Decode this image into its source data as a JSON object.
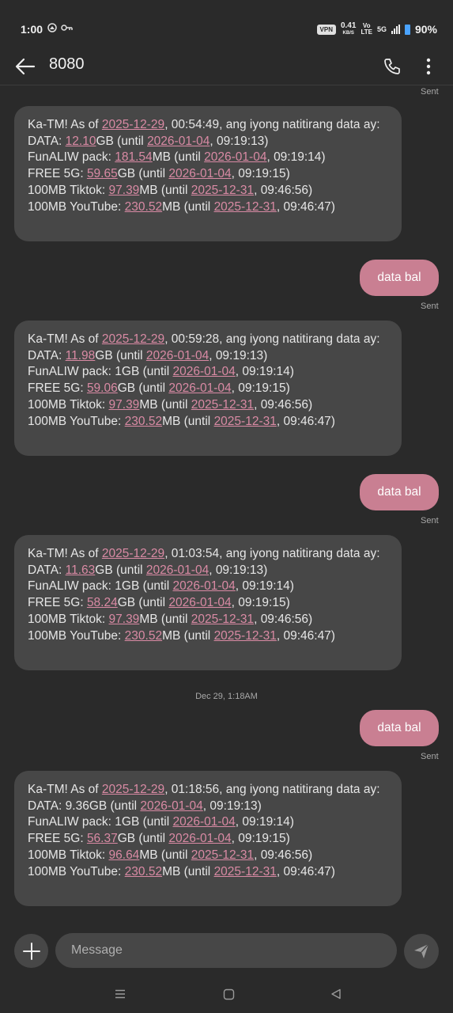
{
  "status_bar": {
    "time": "1:00",
    "vpn": "VPN",
    "net_speed_value": "0.41",
    "net_speed_unit": "KB/S",
    "volte_top": "Vo",
    "volte_bottom": "LTE",
    "network_type": "5G",
    "battery": "90%"
  },
  "header": {
    "title": "8080"
  },
  "thread": {
    "top_status": "Sent",
    "messages": [
      {
        "lines": [
          [
            {
              "t": "Ka-TM! As of "
            },
            {
              "t": "2025-12-29",
              "l": 1
            },
            {
              "t": ", 00:54:49, ang iyong natitirang data ay:"
            }
          ],
          [
            {
              "t": "DATA: "
            },
            {
              "t": "12.10",
              "l": 1
            },
            {
              "t": "GB (until "
            },
            {
              "t": "2026-01-04",
              "l": 1
            },
            {
              "t": ", 09:19:13)"
            }
          ],
          [
            {
              "t": "FunALIW pack: "
            },
            {
              "t": "181.54",
              "l": 1
            },
            {
              "t": "MB (until "
            },
            {
              "t": "2026-01-04",
              "l": 1
            },
            {
              "t": ", 09:19:14)"
            }
          ],
          [
            {
              "t": "FREE 5G: "
            },
            {
              "t": "59.65",
              "l": 1
            },
            {
              "t": "GB (until "
            },
            {
              "t": "2026-01-04",
              "l": 1
            },
            {
              "t": ", 09:19:15)"
            }
          ],
          [
            {
              "t": "100MB Tiktok: "
            },
            {
              "t": "97.39",
              "l": 1
            },
            {
              "t": "MB (until "
            },
            {
              "t": "2025-12-31",
              "l": 1
            },
            {
              "t": ", 09:46:56)"
            }
          ],
          [
            {
              "t": "100MB YouTube: "
            },
            {
              "t": "230.52",
              "l": 1
            },
            {
              "t": "MB (until "
            },
            {
              "t": "2025-12-31",
              "l": 1
            },
            {
              "t": ", 09:46:47)"
            }
          ]
        ]
      },
      {
        "lines": [
          [
            {
              "t": "Ka-TM! As of "
            },
            {
              "t": "2025-12-29",
              "l": 1
            },
            {
              "t": ", 00:59:28, ang iyong natitirang data ay:"
            }
          ],
          [
            {
              "t": "DATA: "
            },
            {
              "t": "11.98",
              "l": 1
            },
            {
              "t": "GB (until "
            },
            {
              "t": "2026-01-04",
              "l": 1
            },
            {
              "t": ", 09:19:13)"
            }
          ],
          [
            {
              "t": "FunALIW pack: 1GB (until "
            },
            {
              "t": "2026-01-04",
              "l": 1
            },
            {
              "t": ", 09:19:14)"
            }
          ],
          [
            {
              "t": "FREE 5G: "
            },
            {
              "t": "59.06",
              "l": 1
            },
            {
              "t": "GB (until "
            },
            {
              "t": "2026-01-04",
              "l": 1
            },
            {
              "t": ", 09:19:15)"
            }
          ],
          [
            {
              "t": "100MB Tiktok: "
            },
            {
              "t": "97.39",
              "l": 1
            },
            {
              "t": "MB (until "
            },
            {
              "t": "2025-12-31",
              "l": 1
            },
            {
              "t": ", 09:46:56)"
            }
          ],
          [
            {
              "t": "100MB YouTube: "
            },
            {
              "t": "230.52",
              "l": 1
            },
            {
              "t": "MB (until "
            },
            {
              "t": "2025-12-31",
              "l": 1
            },
            {
              "t": ", 09:46:47)"
            }
          ]
        ]
      },
      {
        "lines": [
          [
            {
              "t": "Ka-TM! As of "
            },
            {
              "t": "2025-12-29",
              "l": 1
            },
            {
              "t": ", 01:03:54, ang iyong natitirang data ay:"
            }
          ],
          [
            {
              "t": "DATA: "
            },
            {
              "t": "11.63",
              "l": 1
            },
            {
              "t": "GB (until "
            },
            {
              "t": "2026-01-04",
              "l": 1
            },
            {
              "t": ", 09:19:13)"
            }
          ],
          [
            {
              "t": "FunALIW pack: 1GB (until "
            },
            {
              "t": "2026-01-04",
              "l": 1
            },
            {
              "t": ", 09:19:14)"
            }
          ],
          [
            {
              "t": "FREE 5G: "
            },
            {
              "t": "58.24",
              "l": 1
            },
            {
              "t": "GB (until "
            },
            {
              "t": "2026-01-04",
              "l": 1
            },
            {
              "t": ", 09:19:15)"
            }
          ],
          [
            {
              "t": "100MB Tiktok: "
            },
            {
              "t": "97.39",
              "l": 1
            },
            {
              "t": "MB (until "
            },
            {
              "t": "2025-12-31",
              "l": 1
            },
            {
              "t": ", 09:46:56)"
            }
          ],
          [
            {
              "t": "100MB YouTube: "
            },
            {
              "t": "230.52",
              "l": 1
            },
            {
              "t": "MB (until "
            },
            {
              "t": "2025-12-31",
              "l": 1
            },
            {
              "t": ", 09:46:47)"
            }
          ]
        ]
      },
      {
        "lines": [
          [
            {
              "t": "Ka-TM! As of "
            },
            {
              "t": "2025-12-29",
              "l": 1
            },
            {
              "t": ", 01:18:56, ang iyong natitirang data ay:"
            }
          ],
          [
            {
              "t": "DATA: 9.36GB (until "
            },
            {
              "t": "2026-01-04",
              "l": 1
            },
            {
              "t": ", 09:19:13)"
            }
          ],
          [
            {
              "t": "FunALIW pack: 1GB (until "
            },
            {
              "t": "2026-01-04",
              "l": 1
            },
            {
              "t": ", 09:19:14)"
            }
          ],
          [
            {
              "t": "FREE 5G: "
            },
            {
              "t": "56.37",
              "l": 1
            },
            {
              "t": "GB (until "
            },
            {
              "t": "2026-01-04",
              "l": 1
            },
            {
              "t": ", 09:19:15)"
            }
          ],
          [
            {
              "t": "100MB Tiktok: "
            },
            {
              "t": "96.64",
              "l": 1
            },
            {
              "t": "MB (until "
            },
            {
              "t": "2025-12-31",
              "l": 1
            },
            {
              "t": ", 09:46:56)"
            }
          ],
          [
            {
              "t": "100MB YouTube: "
            },
            {
              "t": "230.52",
              "l": 1
            },
            {
              "t": "MB (until "
            },
            {
              "t": "2025-12-31",
              "l": 1
            },
            {
              "t": ", 09:46:47)"
            }
          ]
        ]
      }
    ],
    "outgoing": [
      {
        "text": "data bal",
        "status": "Sent"
      },
      {
        "text": "data bal",
        "status": "Sent"
      },
      {
        "text": "data bal",
        "status": "Sent"
      }
    ],
    "date_divider": "Dec 29, 1:18AM"
  },
  "composer": {
    "placeholder": "Message"
  },
  "colors": {
    "link": "#d98aa4",
    "outgoing_bubble": "#c97f92",
    "incoming_bubble": "#474747",
    "background": "#2a2a2a"
  }
}
